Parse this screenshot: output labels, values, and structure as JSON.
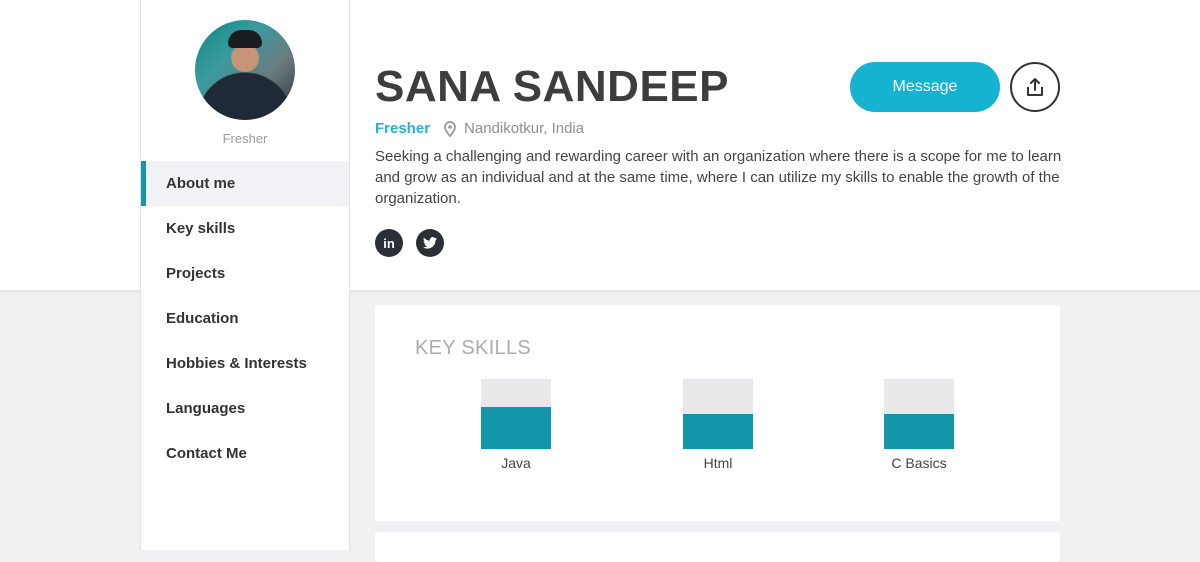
{
  "profile": {
    "name": "SANA SANDEEP",
    "status": "Fresher",
    "avatar_caption": "Fresher",
    "location": "Nandikotkur, India",
    "bio": "Seeking a challenging and rewarding career with an organization where there is a scope for me to learn and grow as an individual and at the same time, where I can utilize my skills to enable the growth of the organization."
  },
  "actions": {
    "message_label": "Message",
    "share_icon": "share-icon"
  },
  "social": [
    {
      "name": "linkedin-icon",
      "glyph": "in"
    },
    {
      "name": "twitter-icon",
      "glyph": "t"
    }
  ],
  "nav": {
    "items": [
      {
        "label": "About me",
        "active": true
      },
      {
        "label": "Key skills",
        "active": false
      },
      {
        "label": "Projects",
        "active": false
      },
      {
        "label": "Education",
        "active": false
      },
      {
        "label": "Hobbies & Interests",
        "active": false
      },
      {
        "label": "Languages",
        "active": false
      },
      {
        "label": "Contact Me",
        "active": false
      }
    ]
  },
  "key_skills": {
    "title": "KEY SKILLS",
    "skills": [
      {
        "name": "Java",
        "level": 0.6
      },
      {
        "name": "Html",
        "level": 0.5
      },
      {
        "name": "C Basics",
        "level": 0.5
      }
    ]
  },
  "colors": {
    "accent": "#15b3cf",
    "bar_fill": "#1396a8",
    "bar_track": "#e9e9ec",
    "dark": "#2b2f36"
  }
}
